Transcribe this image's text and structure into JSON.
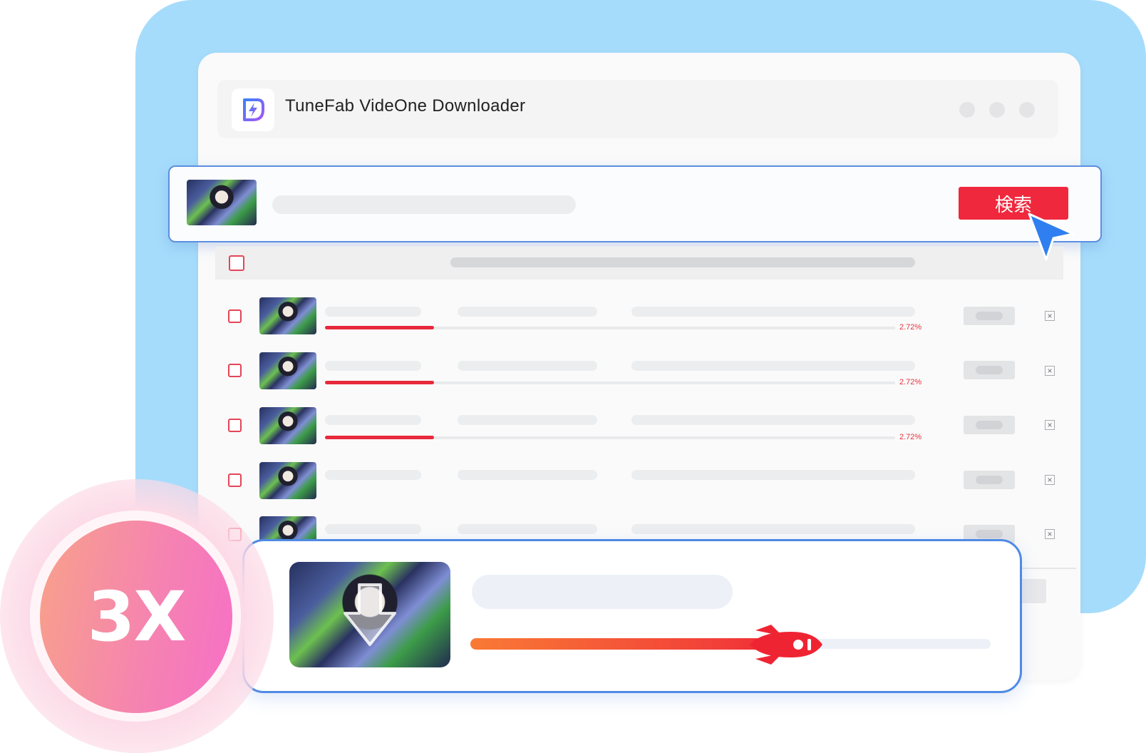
{
  "app": {
    "title": "TuneFab VideOne Downloader"
  },
  "search": {
    "button_label": "検索"
  },
  "downloads": {
    "rows": [
      {
        "progress_label": "2.72%",
        "progress": 0.2
      },
      {
        "progress_label": "2.72%",
        "progress": 0.2
      },
      {
        "progress_label": "2.72%",
        "progress": 0.2
      },
      {
        "progress_label": "",
        "progress": null
      },
      {
        "progress_label": "",
        "progress": null
      }
    ]
  },
  "speed_badge": {
    "label": "3X"
  },
  "featured_download": {
    "progress": 0.63
  },
  "colors": {
    "accent": "#f0283d",
    "background_panel": "#a6dcfb",
    "card_border": "#4f8ae4",
    "cursor": "#2f7ff0"
  },
  "icons": [
    "app-logo-icon",
    "window-dot-icon",
    "checkbox-icon",
    "close-icon",
    "download-arrow-icon",
    "rocket-icon",
    "mouse-cursor-icon"
  ]
}
